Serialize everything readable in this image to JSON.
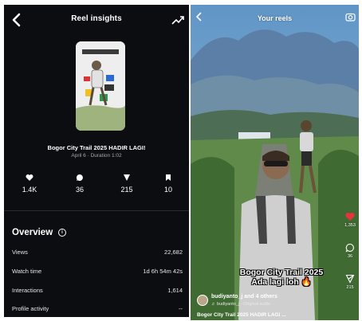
{
  "insights": {
    "title": "Reel insights",
    "reel_title": "Bogor City Trail 2025 HADIR LAGI!",
    "reel_meta": "April 6 · Duration 1:02",
    "stats": [
      {
        "icon": "heart-icon",
        "value": "1.4K"
      },
      {
        "icon": "comment-icon",
        "value": "36"
      },
      {
        "icon": "share-icon",
        "value": "215"
      },
      {
        "icon": "bookmark-icon",
        "value": "10"
      }
    ],
    "overview": {
      "title": "Overview",
      "rows": [
        {
          "label": "Views",
          "value": "22,682"
        },
        {
          "label": "Watch time",
          "value": "1d 6h 54m 42s"
        },
        {
          "label": "Interactions",
          "value": "1,614"
        },
        {
          "label": "Profile activity",
          "value": "--"
        }
      ]
    }
  },
  "reel_view": {
    "title": "Your reels",
    "likes": "1,353",
    "comments": "36",
    "shares": "215",
    "overlay_line1": "Bogor City Trail 2025",
    "overlay_line2": "Ada lagi loh 🔥",
    "author": "budiyanto_j and 4 others",
    "audio": "♬ budiyanto_j · Original audio",
    "caption": "Bogor City Trail 2025 HADIR LAGI ..."
  },
  "colors": {
    "left_bg": "#0c0d11",
    "like_red": "#e8323c"
  }
}
